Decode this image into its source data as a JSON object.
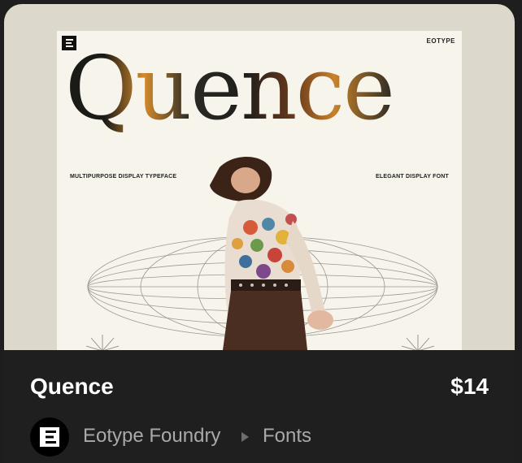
{
  "product": {
    "title": "Quence",
    "price": "$14"
  },
  "poster": {
    "brand": "EOTYPE",
    "headline": "Quence",
    "tagline_left": "MULTIPURPOSE DISPLAY TYPEFACE",
    "tagline_right": "ELEGANT DISPLAY FONT"
  },
  "breadcrumb": {
    "vendor": "Eotype Foundry",
    "category": "Fonts",
    "separator_icon": "triangle-right-icon"
  },
  "colors": {
    "footer_bg": "#1f1f1f",
    "preview_bg": "#ddd8cc",
    "text_primary": "#ffffff",
    "text_secondary": "#a9a9a9",
    "accent_orange": "#d58b2c"
  }
}
